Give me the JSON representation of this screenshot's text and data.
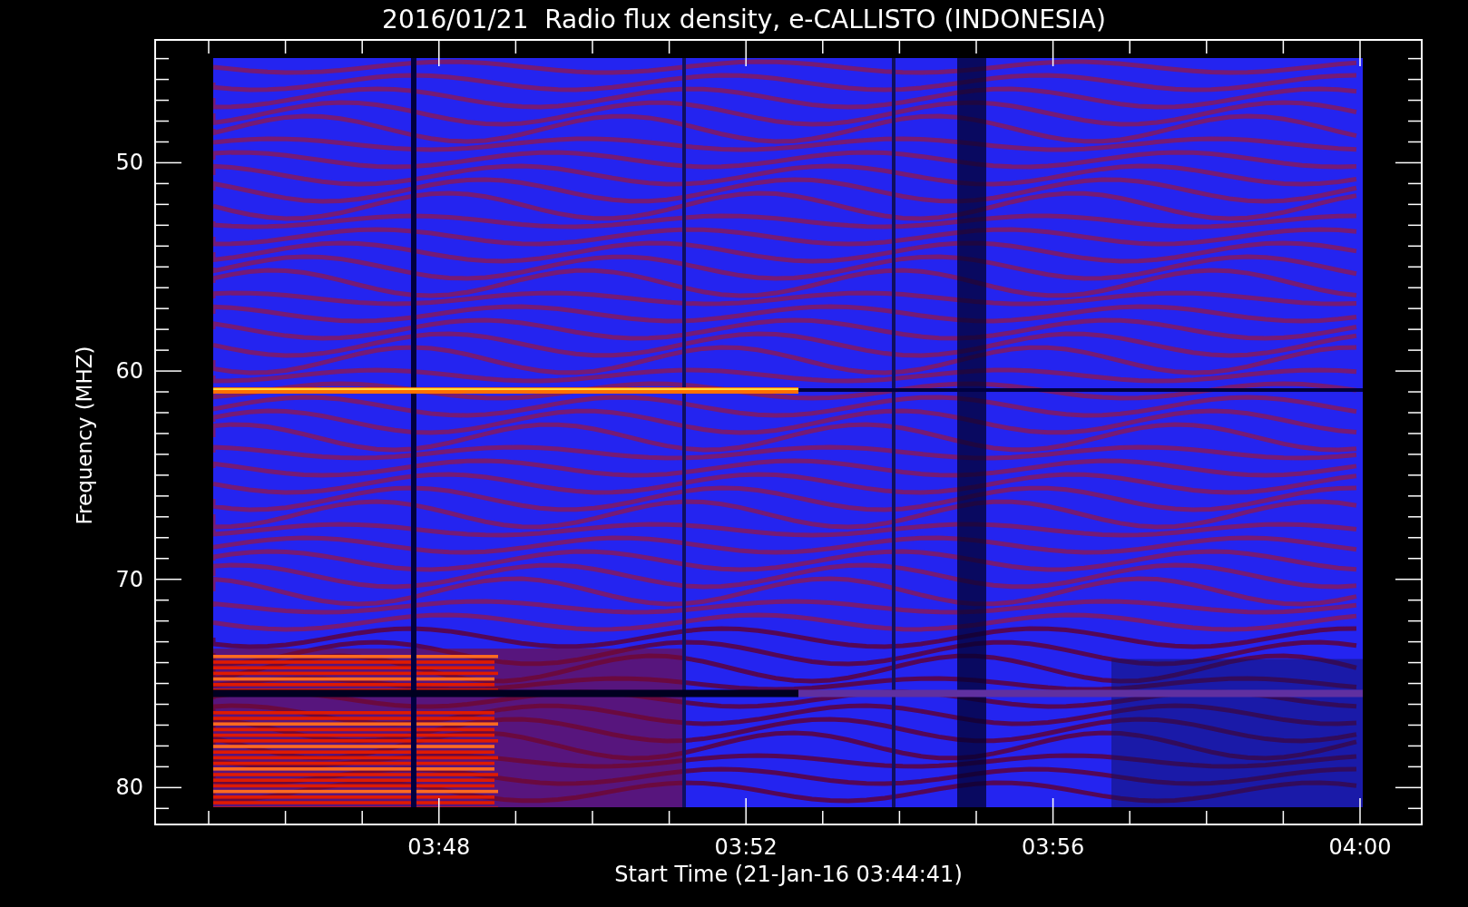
{
  "title": "2016/01/21  Radio flux density, e-CALLISTO (INDONESIA)",
  "y_axis": {
    "label": "Frequency (MHZ)",
    "ticks": [
      "50",
      "60",
      "70",
      "80"
    ]
  },
  "x_axis": {
    "label": "Start Time (21-Jan-16 03:44:41)",
    "ticks": [
      "03:48",
      "03:52",
      "03:56",
      "04:00"
    ]
  }
}
